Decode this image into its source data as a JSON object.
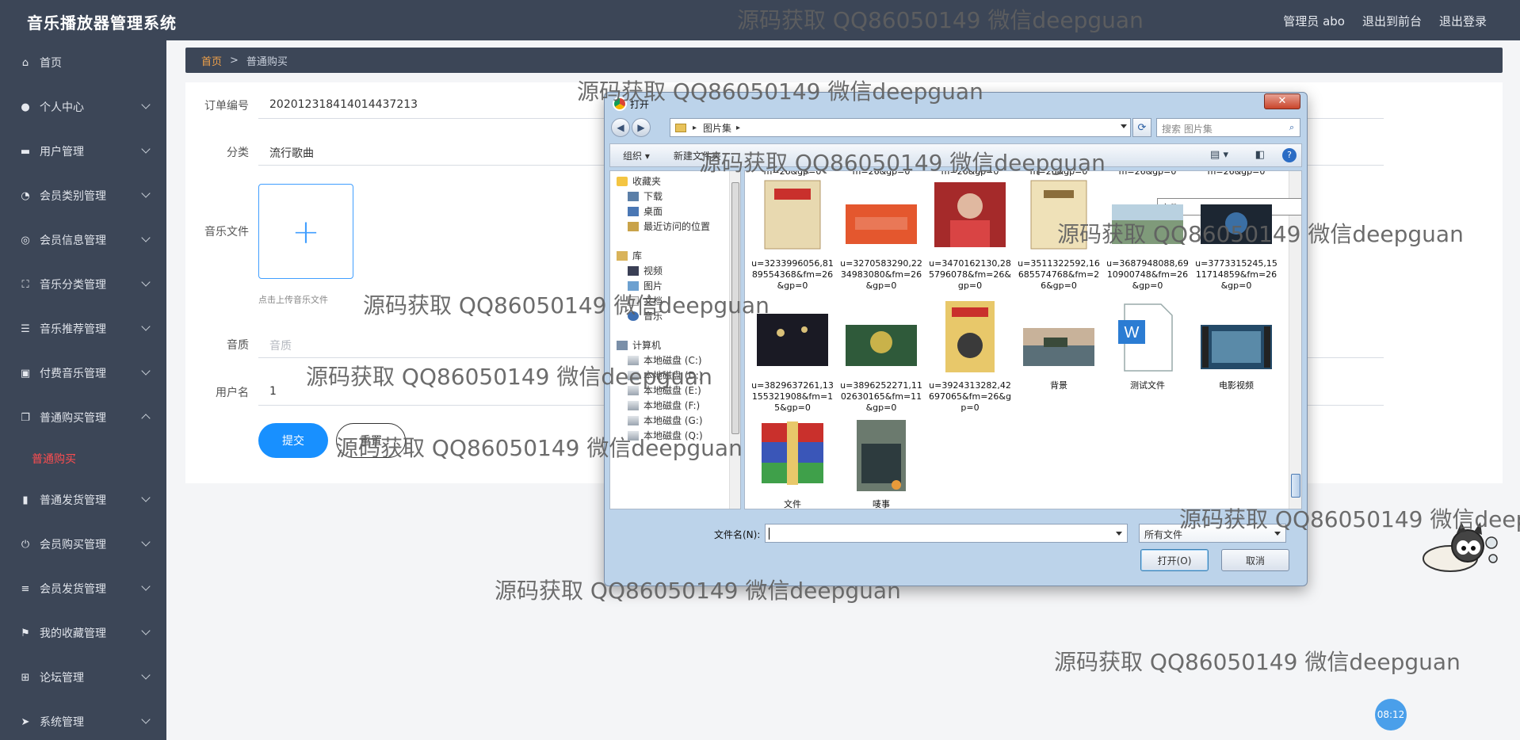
{
  "app": {
    "title": "音乐播放器管理系统",
    "top_links": [
      "管理员 abo",
      "退出到前台",
      "退出登录"
    ]
  },
  "sidebar": {
    "items": [
      {
        "label": "首页",
        "icon": "home-icon",
        "chev": ""
      },
      {
        "label": "个人中心",
        "icon": "user-icon",
        "chev": "down"
      },
      {
        "label": "用户管理",
        "icon": "monitor-icon",
        "chev": "down"
      },
      {
        "label": "会员类别管理",
        "icon": "gauge-icon",
        "chev": "down"
      },
      {
        "label": "会员信息管理",
        "icon": "compass-icon",
        "chev": "down"
      },
      {
        "label": "音乐分类管理",
        "icon": "fullscreen-icon",
        "chev": "down"
      },
      {
        "label": "音乐推荐管理",
        "icon": "sliders-icon",
        "chev": "down"
      },
      {
        "label": "付费音乐管理",
        "icon": "card-icon",
        "chev": "down"
      },
      {
        "label": "普通购买管理",
        "icon": "copy-icon",
        "chev": "up"
      },
      {
        "label": "普通发货管理",
        "icon": "bar-chart-icon",
        "chev": "down"
      },
      {
        "label": "会员购买管理",
        "icon": "power-icon",
        "chev": "down"
      },
      {
        "label": "会员发货管理",
        "icon": "list-icon",
        "chev": "down"
      },
      {
        "label": "我的收藏管理",
        "icon": "flag-icon",
        "chev": "down"
      },
      {
        "label": "论坛管理",
        "icon": "grid-icon",
        "chev": "down"
      },
      {
        "label": "系统管理",
        "icon": "send-icon",
        "chev": "down"
      }
    ],
    "active_sub": "普通购买"
  },
  "breadcrumb": {
    "home": "首页",
    "sep": ">",
    "current": "普通购买"
  },
  "form": {
    "order_label": "订单编号",
    "order_value": "202012318414014437213",
    "category_label": "分类",
    "category_value": "流行歌曲",
    "file_label": "音乐文件",
    "upload_plus": "+",
    "upload_tip": "点击上传音乐文件",
    "quality_label": "音质",
    "quality_placeholder": "音质",
    "username_label": "用户名",
    "username_value": "1",
    "submit_label": "提交",
    "reset_label": "重置"
  },
  "dialog": {
    "title": "打开",
    "close": "✕",
    "path_arrow": "▸",
    "path": "图片集",
    "path_end": "▸",
    "search_placeholder": "搜索 图片集",
    "organize": "组织 ▾",
    "new_folder": "新建文件夹",
    "nav": [
      {
        "label": "收藏夹",
        "type": "star",
        "indent": 0
      },
      {
        "label": "下载",
        "type": "folder",
        "indent": 1
      },
      {
        "label": "桌面",
        "type": "desktop",
        "indent": 1
      },
      {
        "label": "最近访问的位置",
        "type": "recent",
        "indent": 1
      },
      {
        "label": "库",
        "type": "lib",
        "indent": 0
      },
      {
        "label": "视频",
        "type": "video",
        "indent": 1
      },
      {
        "label": "图片",
        "type": "pic",
        "indent": 1
      },
      {
        "label": "文档",
        "type": "doc",
        "indent": 1
      },
      {
        "label": "音乐",
        "type": "music",
        "indent": 1
      },
      {
        "label": "计算机",
        "type": "pc",
        "indent": 0
      },
      {
        "label": "本地磁盘 (C:)",
        "type": "disk",
        "indent": 1
      },
      {
        "label": "本地磁盘 (D:)",
        "type": "disk",
        "indent": 1
      },
      {
        "label": "本地磁盘 (E:)",
        "type": "disk",
        "indent": 1
      },
      {
        "label": "本地磁盘 (F:)",
        "type": "disk",
        "indent": 1
      },
      {
        "label": "本地磁盘 (G:)",
        "type": "disk",
        "indent": 1
      },
      {
        "label": "本地磁盘 (Q:)",
        "type": "disk",
        "indent": 1
      }
    ],
    "partial_labels": [
      "m=26&gp=0",
      "m=26&gp=0",
      "m=26&gp=0",
      "m=26&gp=0",
      "m=26&gp=0",
      "m=26&gp=0"
    ],
    "files": [
      {
        "name": "u=3233996056,8189554368&fm=26&gp=0",
        "thumb": "doc-bag"
      },
      {
        "name": "u=3270583290,2234983080&fm=26&gp=0",
        "thumb": "orange"
      },
      {
        "name": "u=3470162130,285796078&fm=26&gp=0",
        "thumb": "red-photo"
      },
      {
        "name": "u=3511322592,16685574768&fm=26&gp=0",
        "thumb": "doc-bag2"
      },
      {
        "name": "u=3687948088,6910900748&fm=26&gp=0",
        "thumb": "landscape"
      },
      {
        "name": "u=3773315245,1511714859&fm=26&gp=0",
        "thumb": "dark"
      },
      {
        "name": "u=3829637261,13155321908&fm=15&gp=0",
        "thumb": "crowd"
      },
      {
        "name": "u=3896252271,1102630165&fm=11&gp=0",
        "thumb": "green"
      },
      {
        "name": "u=3924313282,42697065&fm=26&gp=0",
        "thumb": "poster"
      },
      {
        "name": "背景",
        "thumb": "lake"
      },
      {
        "name": "测试文件",
        "thumb": "word"
      },
      {
        "name": "电影视频",
        "thumb": "video"
      },
      {
        "name": "文件",
        "thumb": "rar"
      },
      {
        "name": "唛事",
        "thumb": "video2"
      }
    ],
    "tooltip": "文件",
    "filename_label": "文件名(N):",
    "filetype": "所有文件",
    "open_btn": "打开(O)",
    "cancel_btn": "取消"
  },
  "watermark": "源码获取 QQ86050149 微信deepguan",
  "watermark_cut": "源码获取 QQ86050149 微信deep",
  "clock": "08:12"
}
